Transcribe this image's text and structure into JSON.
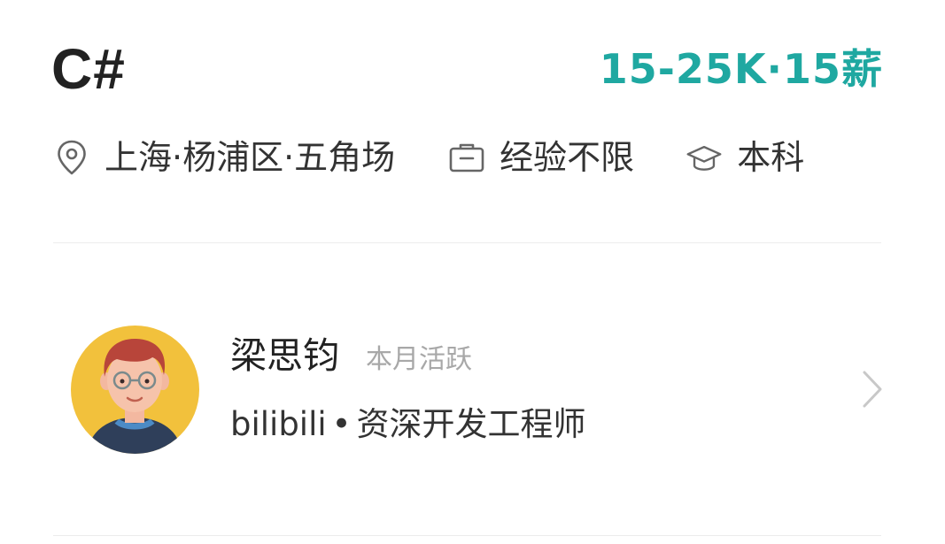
{
  "job": {
    "title": "C#",
    "salary": "15-25K·15薪"
  },
  "tags": {
    "location": "上海·杨浦区·五角场",
    "experience": "经验不限",
    "education": "本科",
    "icons": [
      "location-pin-icon",
      "briefcase-icon",
      "graduation-cap-icon"
    ]
  },
  "recruiter": {
    "name": "梁思钧",
    "activity": "本月活跃",
    "company": "bilibili",
    "separator": "•",
    "position": "资深开发工程师"
  },
  "colors": {
    "accent": "#1fa8a1",
    "title": "#222222",
    "muted": "#a8a8a8",
    "divider": "#ececec",
    "avatar_bg": "#f2c13c"
  }
}
